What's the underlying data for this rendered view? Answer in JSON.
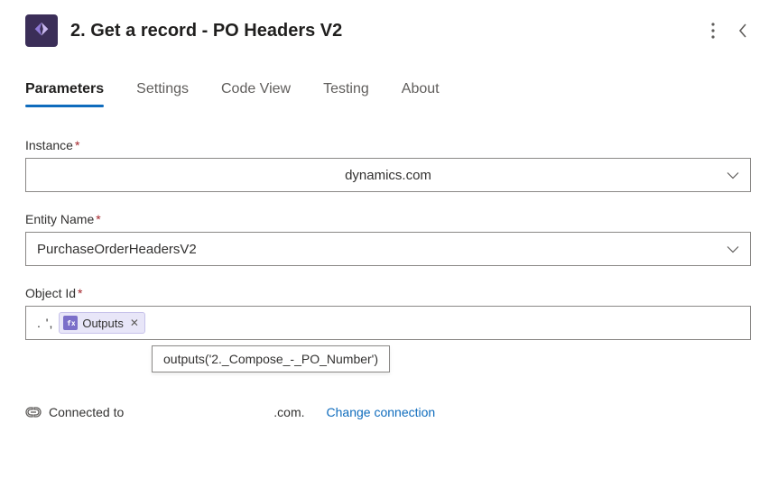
{
  "header": {
    "title": "2. Get a record - PO Headers V2"
  },
  "tabs": [
    {
      "label": "Parameters",
      "active": true
    },
    {
      "label": "Settings",
      "active": false
    },
    {
      "label": "Code View",
      "active": false
    },
    {
      "label": "Testing",
      "active": false
    },
    {
      "label": "About",
      "active": false
    }
  ],
  "fields": {
    "instance": {
      "label": "Instance",
      "required": true,
      "value": "dynamics.com"
    },
    "entity": {
      "label": "Entity Name",
      "required": true,
      "value": "PurchaseOrderHeadersV2"
    },
    "objectId": {
      "label": "Object Id",
      "required": true,
      "prefix": ".  ',",
      "token": {
        "label": "Outputs",
        "expression": "outputs('2._Compose_-_PO_Number')"
      }
    }
  },
  "footer": {
    "connectedLabel": "Connected to",
    "domain": ".com.",
    "changeLabel": "Change connection"
  }
}
